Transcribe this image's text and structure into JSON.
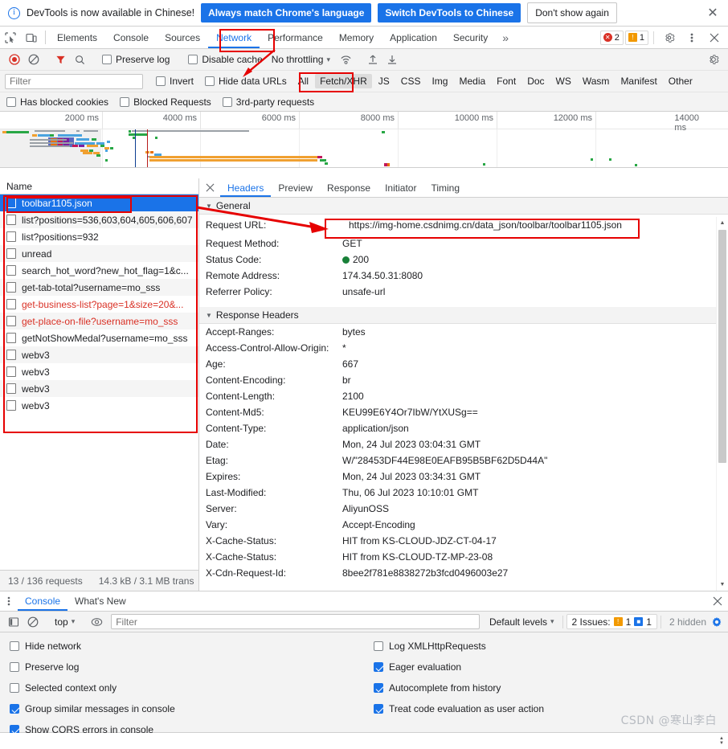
{
  "notification": {
    "icon": "info-icon",
    "message": "DevTools is now available in Chinese!",
    "primary_button": "Always match Chrome's language",
    "secondary_button": "Switch DevTools to Chinese",
    "dismiss_button": "Don't show again",
    "close": "✕"
  },
  "tabbar": {
    "inspect_icon": "inspect-element-icon",
    "device_icon": "device-toolbar-icon",
    "tabs": [
      {
        "label": "Elements",
        "active": false
      },
      {
        "label": "Console",
        "active": false
      },
      {
        "label": "Sources",
        "active": false
      },
      {
        "label": "Network",
        "active": true
      },
      {
        "label": "Performance",
        "active": false
      },
      {
        "label": "Memory",
        "active": false
      },
      {
        "label": "Application",
        "active": false
      },
      {
        "label": "Security",
        "active": false
      }
    ],
    "more_tabs": "»",
    "error_count": "2",
    "warning_count": "1",
    "settings_icon": "gear-icon",
    "more_icon": "kebab-menu-icon",
    "close_icon": "close-icon"
  },
  "network_toolbar": {
    "record_icon": "record-stop-icon",
    "clear_icon": "clear-icon",
    "filter_icon": "filter-funnel-icon",
    "search_icon": "search-icon",
    "preserve_log": {
      "label": "Preserve log",
      "checked": false
    },
    "disable_cache": {
      "label": "Disable cache",
      "checked": false
    },
    "throttling": "No throttling",
    "throttling_caret": "▾",
    "wifi_icon": "network-conditions-icon",
    "import_icon": "import-har-icon",
    "export_icon": "export-har-icon",
    "settings_icon": "network-settings-gear-icon"
  },
  "filter_bar": {
    "filter_placeholder": "Filter",
    "filter_value": "",
    "invert": {
      "label": "Invert",
      "checked": false
    },
    "hide_data_urls": {
      "label": "Hide data URLs",
      "checked": false
    },
    "types": [
      {
        "label": "All",
        "active": false
      },
      {
        "label": "Fetch/XHR",
        "active": true
      },
      {
        "label": "JS",
        "active": false
      },
      {
        "label": "CSS",
        "active": false
      },
      {
        "label": "Img",
        "active": false
      },
      {
        "label": "Media",
        "active": false
      },
      {
        "label": "Font",
        "active": false
      },
      {
        "label": "Doc",
        "active": false
      },
      {
        "label": "WS",
        "active": false
      },
      {
        "label": "Wasm",
        "active": false
      },
      {
        "label": "Manifest",
        "active": false
      },
      {
        "label": "Other",
        "active": false
      }
    ]
  },
  "options_bar": {
    "has_blocked_cookies": {
      "label": "Has blocked cookies",
      "checked": false
    },
    "blocked_requests": {
      "label": "Blocked Requests",
      "checked": false
    },
    "third_party_requests": {
      "label": "3rd-party requests",
      "checked": false
    }
  },
  "overview": {
    "ticks": [
      "2000 ms",
      "4000 ms",
      "6000 ms",
      "8000 ms",
      "10000 ms",
      "12000 ms",
      "14000 ms"
    ]
  },
  "request_list": {
    "column_header": "Name",
    "rows": [
      {
        "name": "toolbar1105.json",
        "selected": true,
        "error": false
      },
      {
        "name": "list?positions=536,603,604,605,606,607",
        "selected": false,
        "error": false
      },
      {
        "name": "list?positions=932",
        "selected": false,
        "error": false
      },
      {
        "name": "unread",
        "selected": false,
        "error": false
      },
      {
        "name": "search_hot_word?new_hot_flag=1&c...",
        "selected": false,
        "error": false
      },
      {
        "name": "get-tab-total?username=mo_sss",
        "selected": false,
        "error": false
      },
      {
        "name": "get-business-list?page=1&size=20&...",
        "selected": false,
        "error": true
      },
      {
        "name": "get-place-on-file?username=mo_sss",
        "selected": false,
        "error": true
      },
      {
        "name": "getNotShowMedal?username=mo_sss",
        "selected": false,
        "error": false
      },
      {
        "name": "webv3",
        "selected": false,
        "error": false
      },
      {
        "name": "webv3",
        "selected": false,
        "error": false
      },
      {
        "name": "webv3",
        "selected": false,
        "error": false
      },
      {
        "name": "webv3",
        "selected": false,
        "error": false
      }
    ],
    "status_requests": "13 / 136 requests",
    "status_transferred": "14.3 kB / 3.1 MB trans"
  },
  "details": {
    "close_icon": "close-icon",
    "tabs": [
      {
        "label": "Headers",
        "active": true
      },
      {
        "label": "Preview",
        "active": false
      },
      {
        "label": "Response",
        "active": false
      },
      {
        "label": "Initiator",
        "active": false
      },
      {
        "label": "Timing",
        "active": false
      }
    ],
    "general": {
      "title": "General",
      "rows": [
        {
          "name": "Request URL:",
          "value": "https://img-home.csdnimg.cn/data_json/toolbar/toolbar1105.json",
          "highlight": true
        },
        {
          "name": "Request Method:",
          "value": "GET"
        },
        {
          "name": "Status Code:",
          "value": "200",
          "status_dot": true
        },
        {
          "name": "Remote Address:",
          "value": "174.34.50.31:8080"
        },
        {
          "name": "Referrer Policy:",
          "value": "unsafe-url"
        }
      ]
    },
    "response_headers": {
      "title": "Response Headers",
      "rows": [
        {
          "name": "Accept-Ranges:",
          "value": "bytes"
        },
        {
          "name": "Access-Control-Allow-Origin:",
          "value": "*"
        },
        {
          "name": "Age:",
          "value": "667"
        },
        {
          "name": "Content-Encoding:",
          "value": "br"
        },
        {
          "name": "Content-Length:",
          "value": "2100"
        },
        {
          "name": "Content-Md5:",
          "value": "KEU99E6Y4Or7IbW/YtXUSg=="
        },
        {
          "name": "Content-Type:",
          "value": "application/json"
        },
        {
          "name": "Date:",
          "value": "Mon, 24 Jul 2023 03:04:31 GMT"
        },
        {
          "name": "Etag:",
          "value": "W/\"28453DF44E98E0EAFB95B5BF62D5D44A\""
        },
        {
          "name": "Expires:",
          "value": "Mon, 24 Jul 2023 03:34:31 GMT"
        },
        {
          "name": "Last-Modified:",
          "value": "Thu, 06 Jul 2023 10:10:01 GMT"
        },
        {
          "name": "Server:",
          "value": "AliyunOSS"
        },
        {
          "name": "Vary:",
          "value": "Accept-Encoding"
        },
        {
          "name": "X-Cache-Status:",
          "value": "HIT from KS-CLOUD-JDZ-CT-04-17"
        },
        {
          "name": "X-Cache-Status:",
          "value": "HIT from KS-CLOUD-TZ-MP-23-08"
        },
        {
          "name": "X-Cdn-Request-Id:",
          "value": "8bee2f781e8838272b3fcd0496003e27"
        }
      ]
    }
  },
  "drawer": {
    "menu_icon": "kebab-menu-icon",
    "tabs": [
      {
        "label": "Console",
        "active": true
      },
      {
        "label": "What's New",
        "active": false
      }
    ],
    "close_icon": "close-icon",
    "toolbar": {
      "sidebar_icon": "console-sidebar-icon",
      "clear_icon": "clear-console-icon",
      "context": "top",
      "context_caret": "▾",
      "eye_icon": "live-expression-icon",
      "filter_placeholder": "Filter",
      "filter_value": "",
      "levels": "Default levels",
      "levels_caret": "▾",
      "issues_label": "2 Issues:",
      "issues_warning_count": "1",
      "issues_info_count": "1",
      "hidden_label": "2 hidden",
      "settings_icon": "console-settings-gear-icon"
    },
    "settings": {
      "left_column": [
        {
          "label": "Hide network",
          "checked": false
        },
        {
          "label": "Preserve log",
          "checked": false
        },
        {
          "label": "Selected context only",
          "checked": false
        },
        {
          "label": "Group similar messages in console",
          "checked": true
        },
        {
          "label": "Show CORS errors in console",
          "checked": true
        }
      ],
      "right_column": [
        {
          "label": "Log XMLHttpRequests",
          "checked": false
        },
        {
          "label": "Eager evaluation",
          "checked": true
        },
        {
          "label": "Autocomplete from history",
          "checked": true
        },
        {
          "label": "Treat code evaluation as user action",
          "checked": true
        }
      ]
    },
    "watermark": "CSDN @寒山李白"
  },
  "colors": {
    "accent": "#1a73e8",
    "error": "#d93025",
    "warning": "#f29900",
    "success": "#188038",
    "annotation": "#e60000"
  }
}
